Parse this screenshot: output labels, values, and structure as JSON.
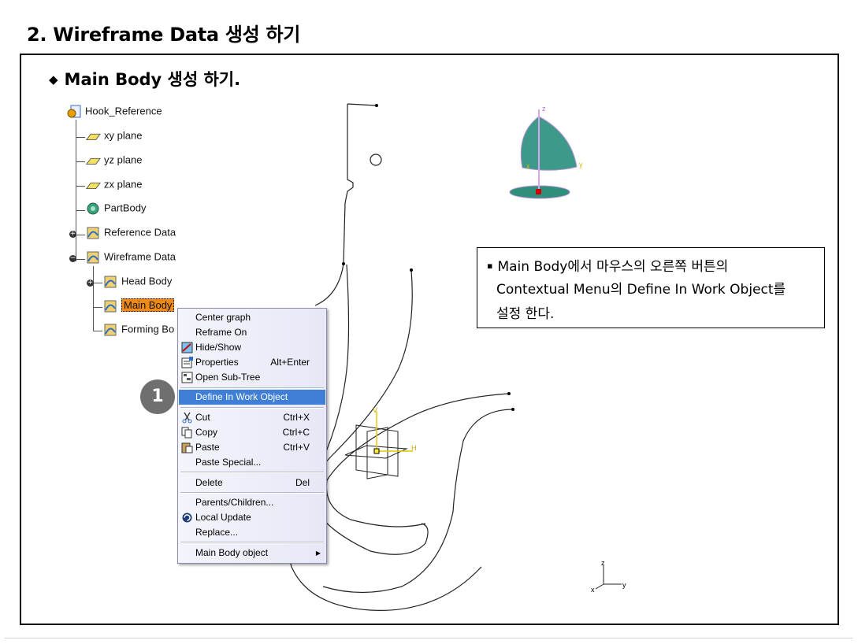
{
  "page_title": "2. Wireframe Data 생성 하기",
  "section": {
    "bullet": "◆",
    "title": "Main Body 생성 하기."
  },
  "tree": {
    "root": "Hook_Reference",
    "nodes": [
      "xy plane",
      "yz plane",
      "zx plane",
      "PartBody",
      "Reference Data",
      "Wireframe Data",
      "Head Body",
      "Main Body",
      "Forming Bo"
    ]
  },
  "context_menu": {
    "items": [
      {
        "label": "Center graph",
        "shortcut": ""
      },
      {
        "label": "Reframe On",
        "shortcut": ""
      },
      {
        "label": "Hide/Show",
        "shortcut": ""
      },
      {
        "label": "Properties",
        "shortcut": "Alt+Enter"
      },
      {
        "label": "Open Sub-Tree",
        "shortcut": ""
      },
      {
        "label": "Define In Work Object",
        "shortcut": ""
      },
      {
        "label": "Cut",
        "shortcut": "Ctrl+X"
      },
      {
        "label": "Copy",
        "shortcut": "Ctrl+C"
      },
      {
        "label": "Paste",
        "shortcut": "Ctrl+V"
      },
      {
        "label": "Paste Special...",
        "shortcut": ""
      },
      {
        "label": "Delete",
        "shortcut": "Del"
      },
      {
        "label": "Parents/Children...",
        "shortcut": ""
      },
      {
        "label": "Local Update",
        "shortcut": ""
      },
      {
        "label": "Replace...",
        "shortcut": ""
      },
      {
        "label": "Main Body object",
        "shortcut": ""
      }
    ],
    "highlighted": "Define In Work Object"
  },
  "step_badge": "1",
  "note": {
    "bullet": "▪",
    "line1": "Main Body에서 마우스의 오른쪽 버튼의",
    "line2": "Contextual Menu의 Define In Work Object를",
    "line3": "설정 한다."
  },
  "axes": {
    "compass": {
      "v": "V",
      "h": "H"
    },
    "corner": {
      "z": "z",
      "y": "y",
      "x": "x"
    },
    "top": {
      "z": "z",
      "x": "x",
      "y": "y"
    }
  },
  "colors": {
    "highlight": "#3f7fd6",
    "selected_node": "#ef8a17",
    "badge": "#6f6f6f"
  }
}
